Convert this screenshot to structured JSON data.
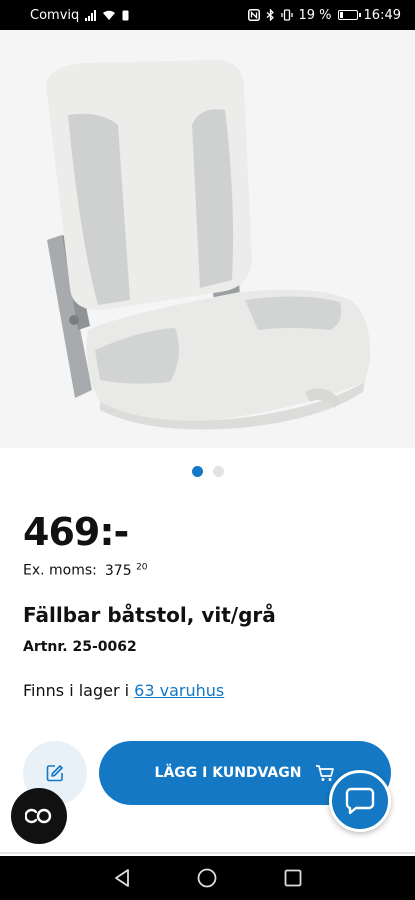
{
  "status_bar": {
    "carrier": "Comviq",
    "battery_percent": "19 %",
    "battery_level": 0.19,
    "time": "16:49"
  },
  "gallery": {
    "image": "boat-seat-image",
    "page_count": 2,
    "active_index": 0
  },
  "product": {
    "price": "469:-",
    "ex_moms_label": "Ex. moms:",
    "ex_moms_value": "375",
    "ex_moms_cents": "20",
    "title": "Fällbar båtstol, vit/grå",
    "artnr": "Artnr. 25-0062",
    "stock_prefix": "Finns i lager i",
    "stock_link": "63 varuhus"
  },
  "actions": {
    "add_to_cart_label": "LÄGG I KUNDVAGN",
    "edit_icon": "edit-icon",
    "cart_icon": "cart-icon",
    "chat_icon": "chat-icon",
    "co_icon": "co-icon"
  },
  "colors": {
    "accent": "#1478c4",
    "edit_button_bg": "#e8f0f8",
    "co_fab_bg": "#111111"
  }
}
